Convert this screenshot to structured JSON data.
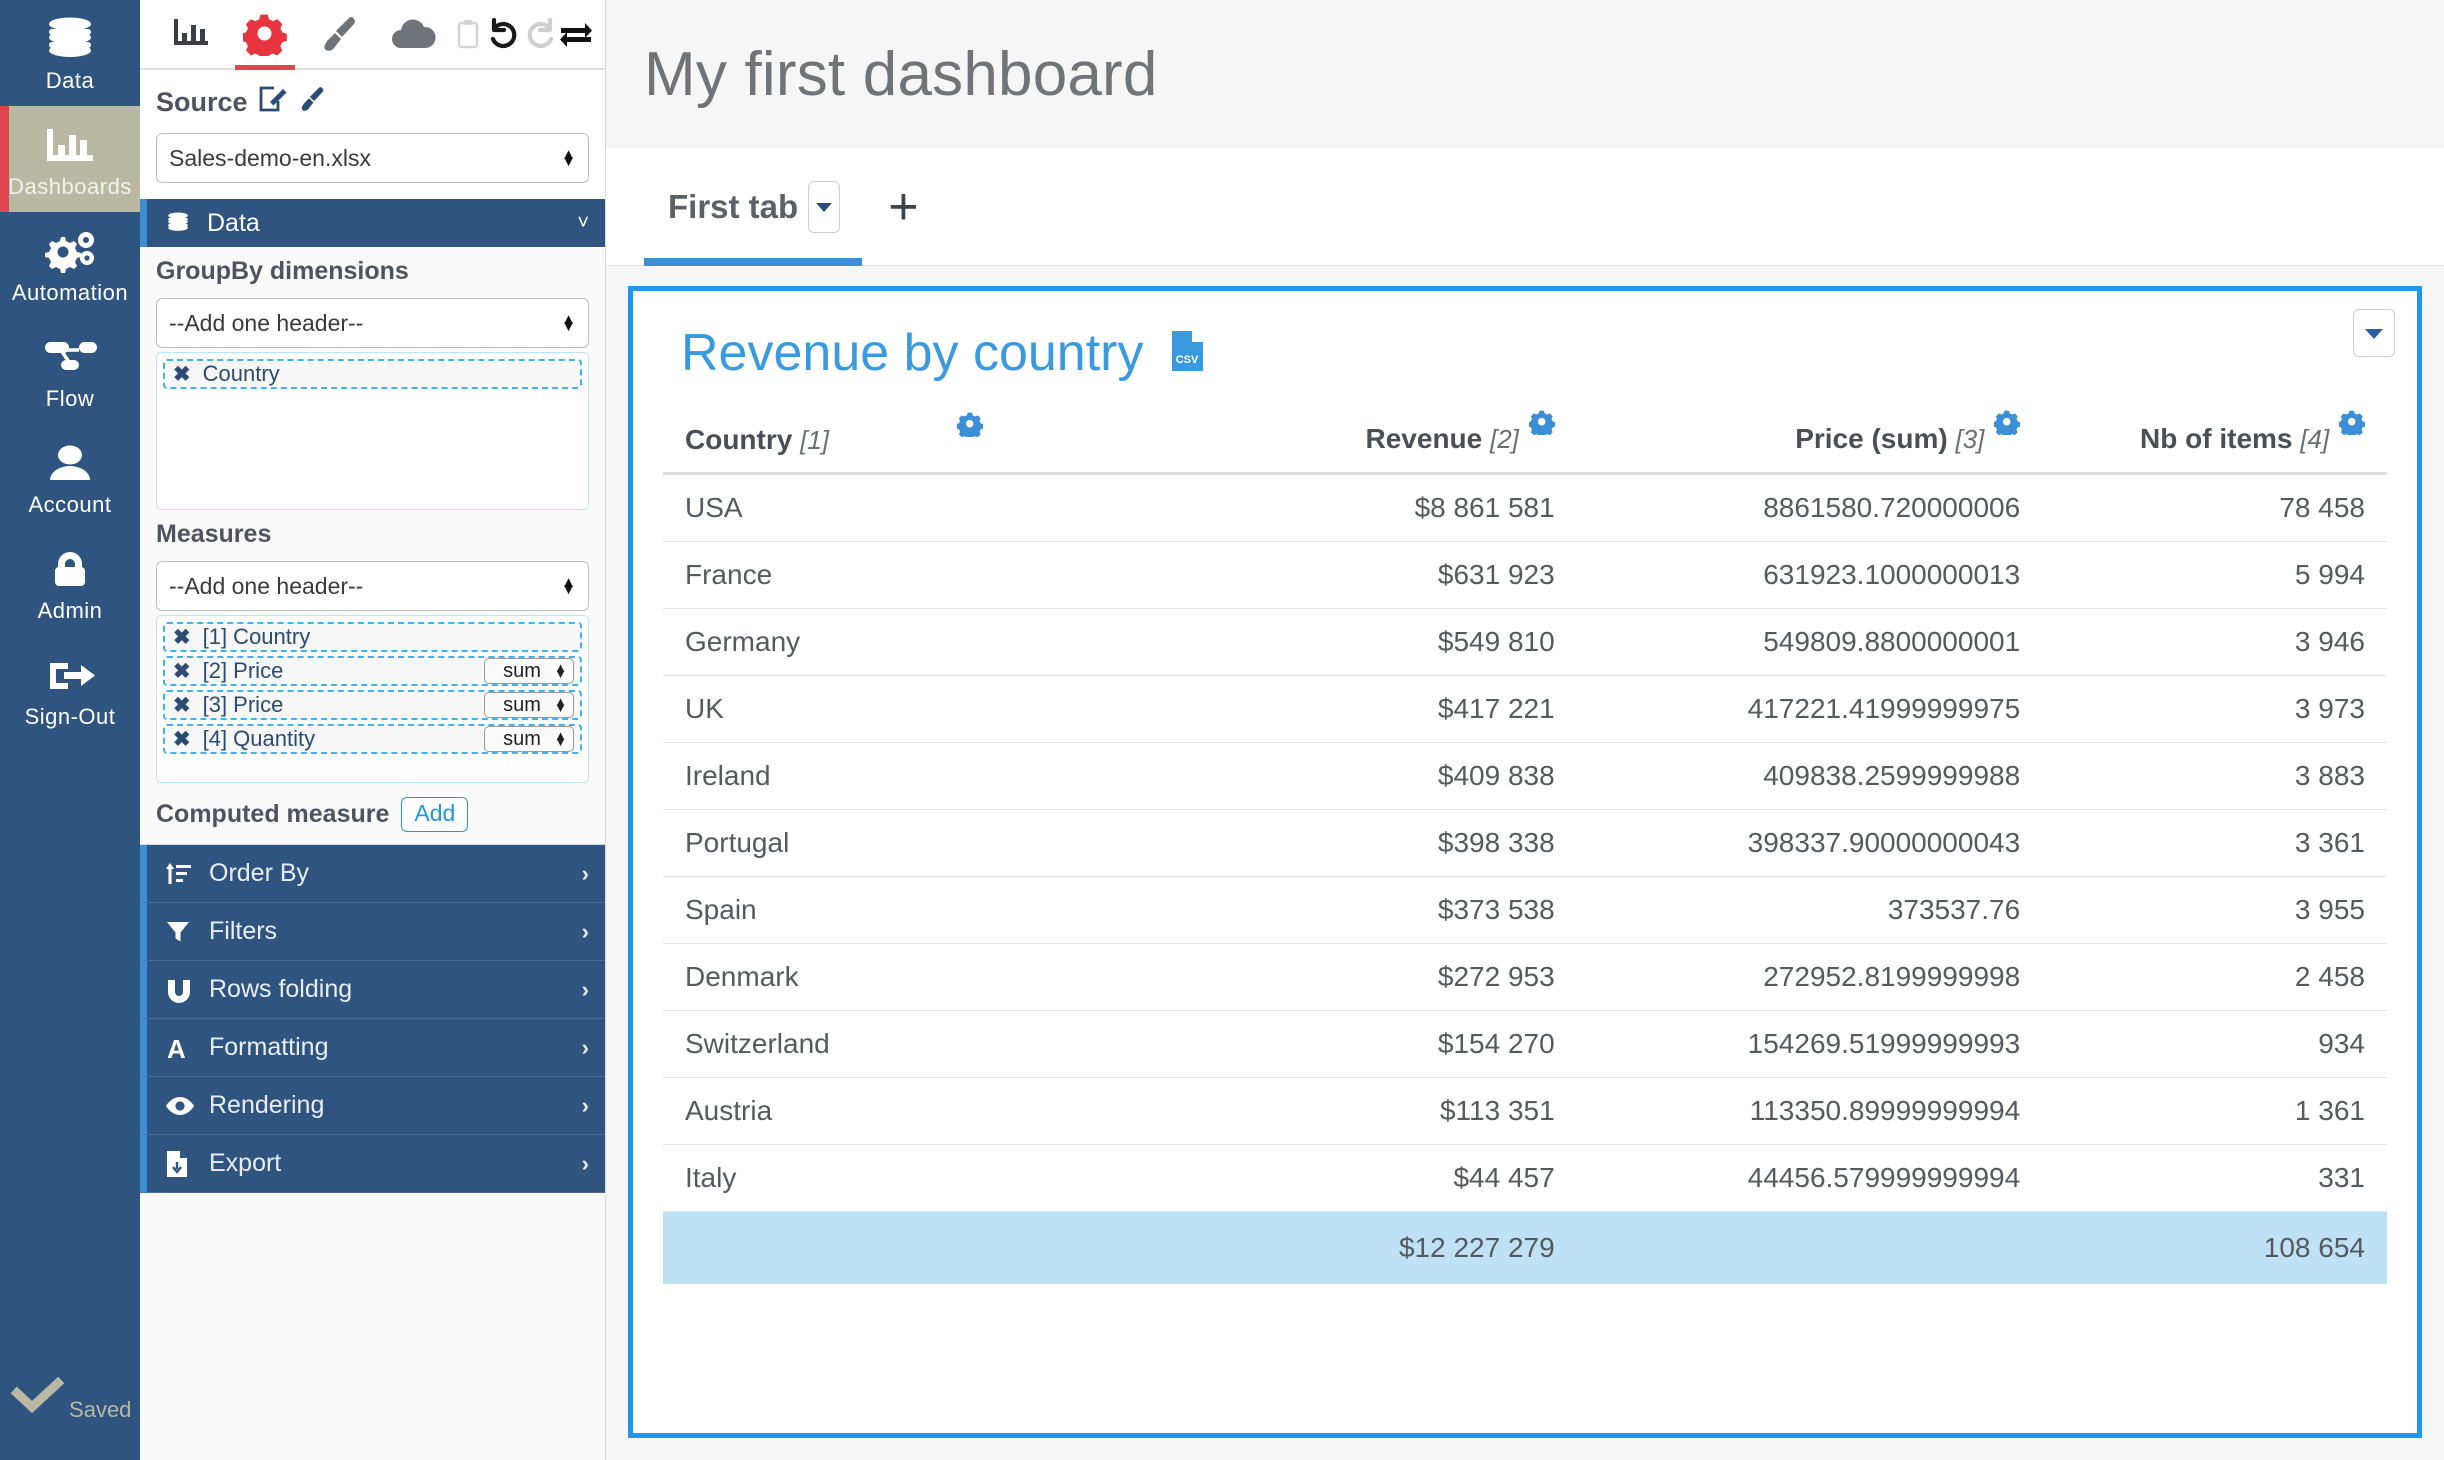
{
  "nav": {
    "items": [
      {
        "label": "Data",
        "icon": "database-icon",
        "active": false
      },
      {
        "label": "Dashboards",
        "icon": "bar-chart-icon",
        "active": true
      },
      {
        "label": "Automation",
        "icon": "gears-icon",
        "active": false
      },
      {
        "label": "Flow",
        "icon": "flow-icon",
        "active": false
      },
      {
        "label": "Account",
        "icon": "user-icon",
        "active": false
      },
      {
        "label": "Admin",
        "icon": "lock-icon",
        "active": false
      },
      {
        "label": "Sign-Out",
        "icon": "sign-out-icon",
        "active": false
      }
    ],
    "saved": {
      "label": "Saved",
      "icon": "check-icon"
    }
  },
  "panel": {
    "toolbar": [
      {
        "name": "chart-icon",
        "active": false
      },
      {
        "name": "gear-icon",
        "active": true
      },
      {
        "name": "paintbrush-icon",
        "active": false
      },
      {
        "name": "cloud-icon",
        "active": false
      },
      {
        "name": "clipboard-icon",
        "active": false
      },
      {
        "name": "undo-icon",
        "active": false
      },
      {
        "name": "redo-icon",
        "active": false
      },
      {
        "name": "swap-icon",
        "active": false
      }
    ],
    "source": {
      "title": "Source",
      "edit_icon": "edit-square-icon",
      "brush_icon": "paintbrush-icon",
      "select_value": "Sales-demo-en.xlsx"
    },
    "data_section": {
      "label": "Data",
      "icon": "database-icon",
      "chevron": "chevron-down-icon"
    },
    "groupby": {
      "label": "GroupBy dimensions",
      "add_placeholder": "--Add one header--",
      "chips": [
        {
          "label": "Country"
        }
      ]
    },
    "measures": {
      "label": "Measures",
      "add_placeholder": "--Add one header--",
      "chips": [
        {
          "label": "[1] Country",
          "agg": null
        },
        {
          "label": "[2] Price",
          "agg": "sum"
        },
        {
          "label": "[3] Price",
          "agg": "sum"
        },
        {
          "label": "[4] Quantity",
          "agg": "sum"
        }
      ]
    },
    "computed_measure": {
      "label": "Computed measure",
      "add_label": "Add"
    },
    "menu": [
      {
        "label": "Order By",
        "icon": "sort-icon"
      },
      {
        "label": "Filters",
        "icon": "funnel-icon"
      },
      {
        "label": "Rows folding",
        "icon": "magnet-icon"
      },
      {
        "label": "Formatting",
        "icon": "font-a-icon"
      },
      {
        "label": "Rendering",
        "icon": "eye-icon"
      },
      {
        "label": "Export",
        "icon": "file-download-icon"
      }
    ]
  },
  "main": {
    "dashboard_title": "My first dashboard",
    "tabs": [
      {
        "label": "First tab",
        "active": true
      }
    ],
    "add_tab_label": "+",
    "widget": {
      "title": "Revenue by country",
      "csv_icon": "csv-file-icon",
      "menu_icon": "chevron-down-icon"
    }
  },
  "chart_data": {
    "type": "table",
    "title": "Revenue by country",
    "columns": [
      {
        "label": "Country",
        "index": "[1]",
        "align": "left"
      },
      {
        "label": "Revenue",
        "index": "[2]",
        "align": "right"
      },
      {
        "label": "Price (sum)",
        "index": "[3]",
        "align": "right"
      },
      {
        "label": "Nb of items",
        "index": "[4]",
        "align": "right"
      }
    ],
    "rows": [
      {
        "country": "USA",
        "revenue": "$8 861 581",
        "price_sum": "8861580.720000006",
        "nb_items": "78 458"
      },
      {
        "country": "France",
        "revenue": "$631 923",
        "price_sum": "631923.1000000013",
        "nb_items": "5 994"
      },
      {
        "country": "Germany",
        "revenue": "$549 810",
        "price_sum": "549809.8800000001",
        "nb_items": "3 946"
      },
      {
        "country": "UK",
        "revenue": "$417 221",
        "price_sum": "417221.41999999975",
        "nb_items": "3 973"
      },
      {
        "country": "Ireland",
        "revenue": "$409 838",
        "price_sum": "409838.2599999988",
        "nb_items": "3 883"
      },
      {
        "country": "Portugal",
        "revenue": "$398 338",
        "price_sum": "398337.90000000043",
        "nb_items": "3 361"
      },
      {
        "country": "Spain",
        "revenue": "$373 538",
        "price_sum": "373537.76",
        "nb_items": "3 955"
      },
      {
        "country": "Denmark",
        "revenue": "$272 953",
        "price_sum": "272952.8199999998",
        "nb_items": "2 458"
      },
      {
        "country": "Switzerland",
        "revenue": "$154 270",
        "price_sum": "154269.51999999993",
        "nb_items": "934"
      },
      {
        "country": "Austria",
        "revenue": "$113 351",
        "price_sum": "113350.89999999994",
        "nb_items": "1 361"
      },
      {
        "country": "Italy",
        "revenue": "$44 457",
        "price_sum": "44456.579999999994",
        "nb_items": "331"
      }
    ],
    "total_row": {
      "country": "",
      "revenue": "$12 227 279",
      "price_sum": "",
      "nb_items": "108 654"
    }
  },
  "colors": {
    "nav_bg": "#2f5480",
    "nav_active_bg": "#b9b9a3",
    "nav_active_marker": "#e0444f",
    "accent_blue": "#2196f3",
    "title_blue": "#3a9ae0",
    "gear_red": "#e0444f",
    "total_row_bg": "#bfe1f5"
  }
}
